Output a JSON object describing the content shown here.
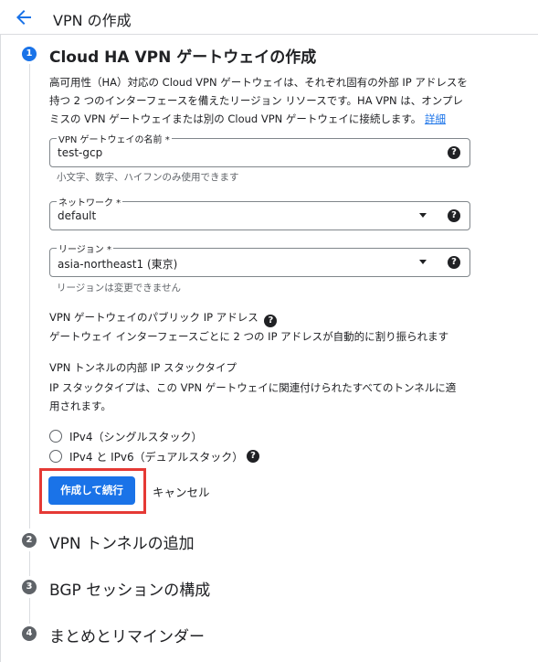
{
  "header": {
    "title": "VPN の作成"
  },
  "steps": [
    {
      "number": "1",
      "title": "Cloud HA VPN ゲートウェイの作成"
    },
    {
      "number": "2",
      "title": "VPN トンネルの追加"
    },
    {
      "number": "3",
      "title": "BGP セッションの構成"
    },
    {
      "number": "4",
      "title": "まとめとリマインダー"
    }
  ],
  "description": {
    "line1": "高可用性（HA）対応の Cloud VPN ゲートウェイは、それぞれ固有の外部 IP アドレスを",
    "line2": "持つ 2 つのインターフェースを備えたリージョン リソースです。HA VPN は、オンプレ",
    "line3": "ミスの VPN ゲートウェイまたは別の Cloud VPN ゲートウェイに接続します。",
    "link": "詳細"
  },
  "fields": {
    "gateway_name": {
      "label": "VPN ゲートウェイの名前 *",
      "value": "test-gcp",
      "hint": "小文字、数字、ハイフンのみ使用できます"
    },
    "network": {
      "label": "ネットワーク *",
      "value": "default"
    },
    "region": {
      "label": "リージョン *",
      "value": "asia-northeast1 (東京)",
      "hint": "リージョンは変更できません"
    }
  },
  "public_ip": {
    "heading": "VPN ゲートウェイのパブリック IP アドレス",
    "text": "ゲートウェイ インターフェースごとに 2 つの IP アドレスが自動的に割り振られます"
  },
  "stack_type": {
    "heading": "VPN トンネルの内部 IP スタックタイプ",
    "text_line1": "IP スタックタイプは、この VPN ゲートウェイに関連付けられたすべてのトンネルに適",
    "text_line2": "用されます。",
    "options": [
      "IPv4（シングルスタック）",
      "IPv4 と IPv6（デュアルスタック）"
    ]
  },
  "actions": {
    "create_label": "作成して続行",
    "cancel_label": "キャンセル"
  },
  "colors": {
    "accent": "#1a73e8",
    "highlight": "#e53935"
  }
}
